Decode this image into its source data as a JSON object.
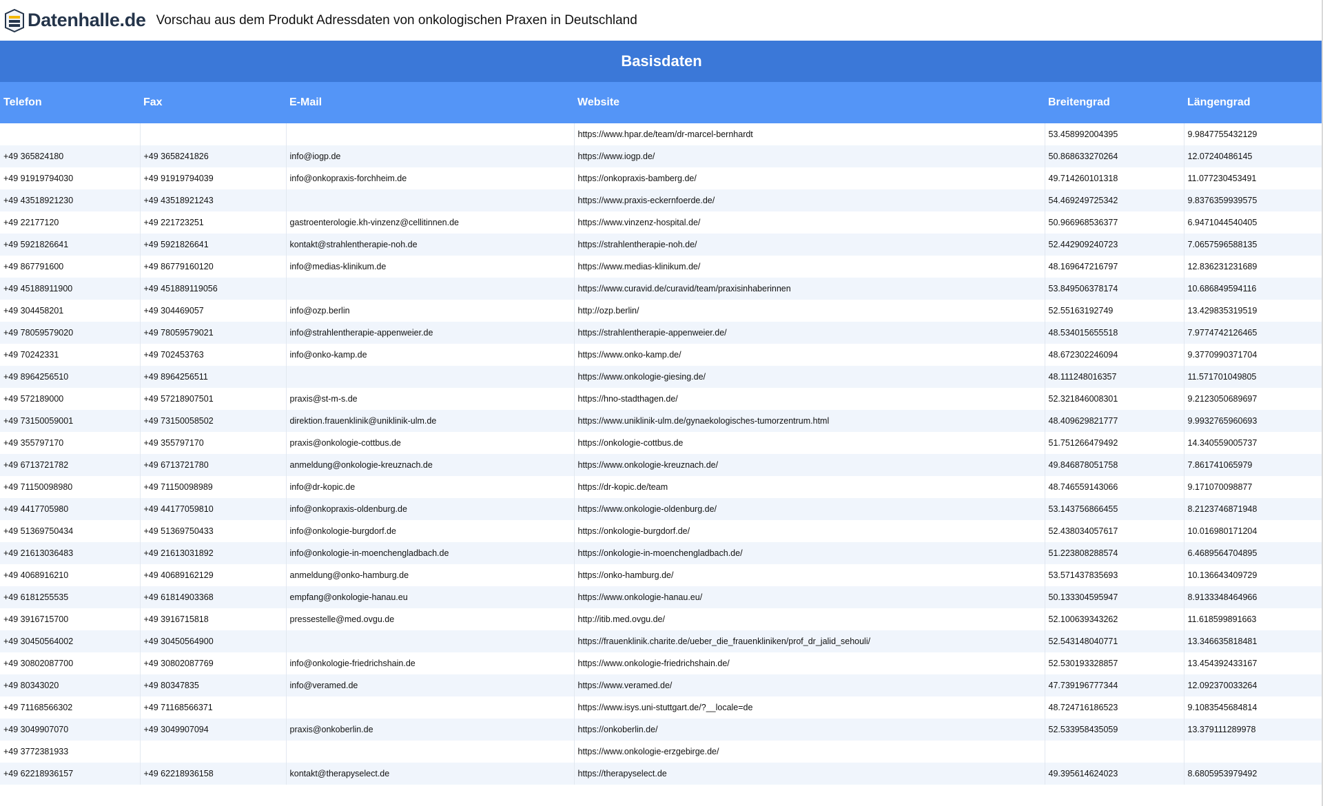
{
  "header": {
    "logo_text": "Datenhalle.de",
    "title": "Vorschau aus dem Produkt Adressdaten von onkologischen Praxen in Deutschland"
  },
  "table": {
    "section_title": "Basisdaten",
    "columns": [
      "Telefon",
      "Fax",
      "E-Mail",
      "Website",
      "Breitengrad",
      "Längengrad"
    ],
    "rows": [
      [
        "",
        "",
        "",
        "https://www.hpar.de/team/dr-marcel-bernhardt",
        "53.458992004395",
        "9.9847755432129"
      ],
      [
        "+49 365824180",
        "+49 3658241826",
        "info@iogp.de",
        "https://www.iogp.de/",
        "50.868633270264",
        "12.07240486145"
      ],
      [
        "+49 91919794030",
        "+49 91919794039",
        "info@onkopraxis-forchheim.de",
        "https://onkopraxis-bamberg.de/",
        "49.714260101318",
        "11.077230453491"
      ],
      [
        "+49 43518921230",
        "+49 43518921243",
        "",
        "https://www.praxis-eckernfoerde.de/",
        "54.469249725342",
        "9.8376359939575"
      ],
      [
        "+49 22177120",
        "+49 221723251",
        "gastroenterologie.kh-vinzenz@cellitinnen.de",
        "https://www.vinzenz-hospital.de/",
        "50.966968536377",
        "6.9471044540405"
      ],
      [
        "+49 5921826641",
        "+49 5921826641",
        "kontakt@strahlentherapie-noh.de",
        "https://strahlentherapie-noh.de/",
        "52.442909240723",
        "7.0657596588135"
      ],
      [
        "+49 867791600",
        "+49 86779160120",
        "info@medias-klinikum.de",
        "https://www.medias-klinikum.de/",
        "48.169647216797",
        "12.836231231689"
      ],
      [
        "+49 45188911900",
        "+49 451889119056",
        "",
        "https://www.curavid.de/curavid/team/praxisinhaberinnen",
        "53.849506378174",
        "10.686849594116"
      ],
      [
        "+49 304458201",
        "+49 304469057",
        "info@ozp.berlin",
        "http://ozp.berlin/",
        "52.55163192749",
        "13.429835319519"
      ],
      [
        "+49 78059579020",
        "+49 78059579021",
        "info@strahlentherapie-appenweier.de",
        "https://strahlentherapie-appenweier.de/",
        "48.534015655518",
        "7.9774742126465"
      ],
      [
        "+49 70242331",
        "+49 702453763",
        "info@onko-kamp.de",
        "https://www.onko-kamp.de/",
        "48.672302246094",
        "9.3770990371704"
      ],
      [
        "+49 8964256510",
        "+49 8964256511",
        "",
        "https://www.onkologie-giesing.de/",
        "48.111248016357",
        "11.571701049805"
      ],
      [
        "+49 572189000",
        "+49 57218907501",
        "praxis@st-m-s.de",
        "https://hno-stadthagen.de/",
        "52.321846008301",
        "9.2123050689697"
      ],
      [
        "+49 73150059001",
        "+49 73150058502",
        "direktion.frauenklinik@uniklinik-ulm.de",
        "https://www.uniklinik-ulm.de/gynaekologisches-tumorzentrum.html",
        "48.409629821777",
        "9.9932765960693"
      ],
      [
        "+49 355797170",
        "+49 355797170",
        "praxis@onkologie-cottbus.de",
        "https://onkologie-cottbus.de",
        "51.751266479492",
        "14.340559005737"
      ],
      [
        "+49 6713721782",
        "+49 6713721780",
        "anmeldung@onkologie-kreuznach.de",
        "https://www.onkologie-kreuznach.de/",
        "49.846878051758",
        "7.861741065979"
      ],
      [
        "+49 71150098980",
        "+49 71150098989",
        "info@dr-kopic.de",
        "https://dr-kopic.de/team",
        "48.746559143066",
        "9.171070098877"
      ],
      [
        "+49 4417705980",
        "+49 44177059810",
        "info@onkopraxis-oldenburg.de",
        "https://www.onkologie-oldenburg.de/",
        "53.143756866455",
        "8.2123746871948"
      ],
      [
        "+49 51369750434",
        "+49 51369750433",
        "info@onkologie-burgdorf.de",
        "https://onkologie-burgdorf.de/",
        "52.438034057617",
        "10.016980171204"
      ],
      [
        "+49 21613036483",
        "+49 21613031892",
        "info@onkologie-in-moenchengladbach.de",
        "https://onkologie-in-moenchengladbach.de/",
        "51.223808288574",
        "6.4689564704895"
      ],
      [
        "+49 4068916210",
        "+49 40689162129",
        "anmeldung@onko-hamburg.de",
        "https://onko-hamburg.de/",
        "53.571437835693",
        "10.136643409729"
      ],
      [
        "+49 6181255535",
        "+49 61814903368",
        "empfang@onkologie-hanau.eu",
        "https://www.onkologie-hanau.eu/",
        "50.133304595947",
        "8.9133348464966"
      ],
      [
        "+49 3916715700",
        "+49 3916715818",
        "pressestelle@med.ovgu.de",
        "http://itib.med.ovgu.de/",
        "52.100639343262",
        "11.618599891663"
      ],
      [
        "+49 30450564002",
        "+49 30450564900",
        "",
        "https://frauenklinik.charite.de/ueber_die_frauenkliniken/prof_dr_jalid_sehouli/",
        "52.543148040771",
        "13.346635818481"
      ],
      [
        "+49 30802087700",
        "+49 30802087769",
        "info@onkologie-friedrichshain.de",
        "https://www.onkologie-friedrichshain.de/",
        "52.530193328857",
        "13.454392433167"
      ],
      [
        "+49 80343020",
        "+49 80347835",
        "info@veramed.de",
        "https://www.veramed.de/",
        "47.739196777344",
        "12.092370033264"
      ],
      [
        "+49 71168566302",
        "+49 71168566371",
        "",
        "https://www.isys.uni-stuttgart.de/?__locale=de",
        "48.724716186523",
        "9.1083545684814"
      ],
      [
        "+49 3049907070",
        "+49 3049907094",
        "praxis@onkoberlin.de",
        "https://onkoberlin.de/",
        "52.533958435059",
        "13.379111289978"
      ],
      [
        "+49 3772381933",
        "",
        "",
        "https://www.onkologie-erzgebirge.de/",
        "",
        ""
      ],
      [
        "+49 62218936157",
        "+49 62218936158",
        "kontakt@therapyselect.de",
        "https://therapyselect.de",
        "49.395614624023",
        "8.6805953979492"
      ]
    ]
  }
}
